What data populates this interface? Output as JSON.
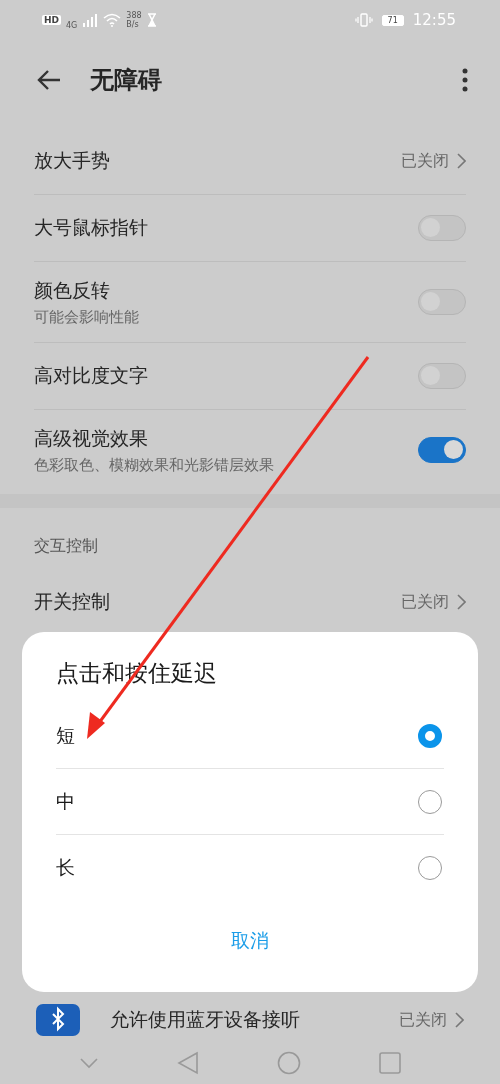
{
  "status_bar": {
    "hd": "HD",
    "network": "4G",
    "speed": "388",
    "speed_unit": "B/s",
    "battery": "71",
    "time": "12:55"
  },
  "header": {
    "title": "无障碍"
  },
  "sections": [
    {
      "items": [
        {
          "kind": "link",
          "title": "放大手势",
          "value": "已关闭"
        },
        {
          "kind": "toggle",
          "title": "大号鼠标指针",
          "on": false
        },
        {
          "kind": "toggle",
          "title": "颜色反转",
          "subtitle": "可能会影响性能",
          "on": false
        },
        {
          "kind": "toggle",
          "title": "高对比度文字",
          "on": false
        },
        {
          "kind": "toggle",
          "title": "高级视觉效果",
          "subtitle": "色彩取色、模糊效果和光影错层效果",
          "on": true
        }
      ]
    },
    {
      "title": "交互控制",
      "items": [
        {
          "kind": "link",
          "title": "开关控制",
          "value": "已关闭"
        }
      ]
    }
  ],
  "bluetooth_row": {
    "title": "允许使用蓝牙设备接听",
    "value": "已关闭"
  },
  "dialog": {
    "title": "点击和按住延迟",
    "options": [
      {
        "label": "短",
        "selected": true
      },
      {
        "label": "中",
        "selected": false
      },
      {
        "label": "长",
        "selected": false
      }
    ],
    "cancel": "取消"
  }
}
